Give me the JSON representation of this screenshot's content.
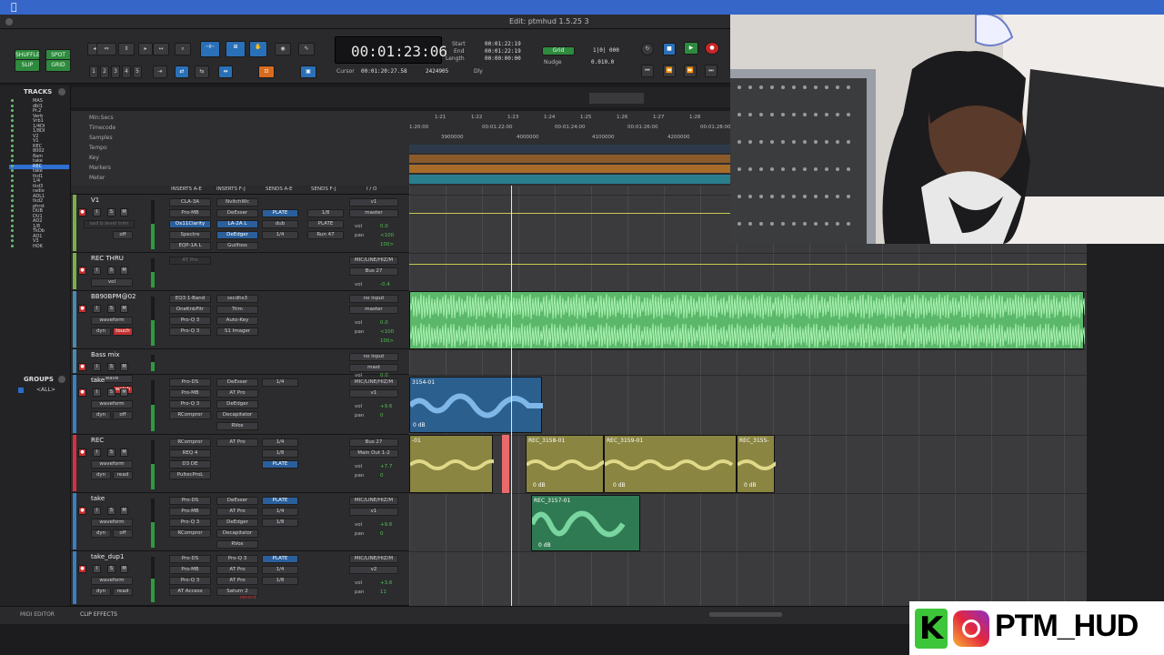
{
  "system": {
    "apple": ""
  },
  "window": {
    "title": "Edit: ptmhud 1.5.25 3"
  },
  "toolbar": {
    "modes": [
      "SHUFFLE",
      "SPOT",
      "SLIP",
      "GRID"
    ],
    "zoom_presets": [
      "1",
      "2",
      "3",
      "4",
      "5"
    ],
    "counter": "00:01:23:06",
    "start_label": "Start",
    "end_label": "End",
    "length_label": "Length",
    "start_val": "00:01:22:19",
    "end_val": "00:01:22:19",
    "length_val": "00:00:00:00",
    "cursor_label": "Cursor",
    "cursor_val": "00:01:20:27.58",
    "samples_val": "2424905",
    "dly_label": "Dly",
    "grid_label": "Grid",
    "grid_val": "1|0| 000",
    "nudge_label": "Nudge",
    "nudge_val": "0.010.0"
  },
  "tracks_panel": {
    "header": "TRACKS",
    "items": [
      "MAS",
      "dbl1",
      "Pr.2",
      "Verb",
      "Vrb1",
      "1/4DI",
      "1/8DI",
      "V2",
      "V1",
      "REC",
      "8002",
      "8am",
      "take",
      "REC",
      "take",
      "tkd1",
      "1/4",
      "tkd3",
      "radio",
      "ADL1",
      "tkd2",
      "phrst",
      "DUB",
      "DU1",
      "AD2",
      "1/8",
      "TkDb",
      "AD1",
      "V3",
      "HOK"
    ],
    "selected_index": 13
  },
  "groups_panel": {
    "header": "GROUPS",
    "items": [
      "<ALL>"
    ]
  },
  "rulers": {
    "labels": [
      "Min:Secs",
      "Timecode",
      "Samples",
      "Tempo",
      "Key",
      "Markers",
      "Meter"
    ],
    "min_secs": [
      "1:21",
      "1:22",
      "1:23",
      "1:24",
      "1:25",
      "1:26",
      "1:27",
      "1:28"
    ],
    "timecode": [
      "1:20:00",
      "00:01:22:00",
      "00:01:24:00",
      "00:01:26:00",
      "00:01:28:00"
    ],
    "samples": [
      "3900000",
      "4000000",
      "4100000",
      "4200000"
    ]
  },
  "mixer_headers": {
    "inserts_ae": "INSERTS A-E",
    "inserts_fj": "INSERTS F-J",
    "sends_ae": "SENDS A-E",
    "sends_fj": "SENDS F-J",
    "io": "I / O"
  },
  "tracks": [
    {
      "name": "V1",
      "inserts_ae": [
        "CLA-3A",
        "Pro-MB",
        "Ox11Clarity",
        "Spectre",
        "EQP-1A L"
      ],
      "inserts_fj": [
        "NvitchWc",
        "DeEsser",
        "LA-2A L",
        "DeEdger",
        "Guilfoss"
      ],
      "sends": [
        "PLATE",
        "dub",
        "1/4"
      ],
      "sends2": [
        "1/8",
        "PLATE",
        "Run 47"
      ],
      "io": [
        "v1",
        "master"
      ],
      "vol": "0.0",
      "pan": "<100",
      "pan2": "100>",
      "sub": "sad b level trim",
      "mode": "dyn",
      "auto": "off"
    },
    {
      "name": "REC THRU",
      "inserts_ae": [
        "AT Pro"
      ],
      "io": [
        "MIC/LINE/HIZ/M",
        "Bus 27"
      ],
      "vol": "-0.4",
      "mode": "vol"
    },
    {
      "name": "BB90BPM@02",
      "inserts_ae": [
        "EQ3 1-Band",
        "OneKnbFitr",
        "Pro-Q 3",
        "Pro-Q 3"
      ],
      "inserts_fj": [
        "sscdhs3",
        "Trim",
        "Auto-Key",
        "S1 Imager"
      ],
      "io": [
        "no input",
        "master"
      ],
      "vol": "0.0",
      "pan": "<100",
      "pan2": "100>",
      "mode": "waveform",
      "auto": "touch",
      "dyn": "dyn"
    },
    {
      "name": "Bass mix",
      "mode": "wave",
      "auto": "watch",
      "io": [
        "no input",
        "mast"
      ],
      "vol": "0.0"
    },
    {
      "name": "take",
      "inserts_ae": [
        "Pro-DS",
        "Pro-MB",
        "Pro-Q 3",
        "RCompror"
      ],
      "inserts_fj": [
        "DeEsser",
        "AT Pro",
        "DeEdger",
        "Decapitator",
        "RVox"
      ],
      "sends": [
        "1/4"
      ],
      "io": [
        "MIC/LINE/HIZ/M",
        "v1"
      ],
      "vol": "+9.6",
      "pan": "0",
      "mode": "waveform",
      "auto": "off",
      "dyn": "dyn"
    },
    {
      "name": "REC",
      "inserts_ae": [
        "RCompror",
        "REQ 4",
        "D3 DE",
        "PultecProL"
      ],
      "inserts_fj": [
        "AT Pro"
      ],
      "sends": [
        "1/4",
        "1/8",
        "PLATE"
      ],
      "io": [
        "Bus 27",
        "Main Out 1-2"
      ],
      "vol": "+7.7",
      "pan": "0",
      "mode": "waveform",
      "auto": "read",
      "dyn": "dyn"
    },
    {
      "name": "take",
      "inserts_ae": [
        "Pro-DS",
        "Pro-MB",
        "Pro-Q 3",
        "RCompror"
      ],
      "inserts_fj": [
        "DeEsser",
        "AT Pro",
        "DeEdger",
        "Decapitator",
        "RVox"
      ],
      "sends": [
        "PLATE",
        "1/4",
        "1/8"
      ],
      "io": [
        "MIC/LINE/HIZ/M",
        "v1"
      ],
      "vol": "+9.6",
      "pan": "0",
      "mode": "waveform",
      "auto": "off",
      "dyn": "dyn"
    },
    {
      "name": "take_dup1",
      "inserts_ae": [
        "Pro-DS",
        "Pro-MB",
        "Pro-Q 3",
        "AT Access"
      ],
      "inserts_fj": [
        "Pro-Q 3",
        "AT Pro",
        "AT Pro",
        "Saturn 2"
      ],
      "sends": [
        "PLATE",
        "1/4",
        "1/8"
      ],
      "io": [
        "MIC/LINE/HIZ/M",
        "v2"
      ],
      "vol": "+3.6",
      "pan": "11",
      "mode": "waveform",
      "auto": "read",
      "dyn": "dyn",
      "extra": "record"
    }
  ],
  "clips": [
    {
      "name": "3154-01",
      "track": 4
    },
    {
      "name": "-01",
      "track": 5
    },
    {
      "name": "REC_3158-01",
      "track": 5
    },
    {
      "name": "REC_3159-01",
      "track": 5
    },
    {
      "name": "REC_3155-",
      "track": 5
    },
    {
      "name": "REC_3157-01",
      "track": 6
    }
  ],
  "clip_gain": [
    "0 dB",
    "0 dB",
    "0 dB",
    "0 dB",
    "0 dB"
  ],
  "bottom": {
    "midi_editor": "MIDI EDITOR",
    "clip_effects": "CLIP EFFECTS"
  },
  "brand": {
    "handle": "PTM_HUD",
    "k_letter": "K"
  },
  "colors": {
    "accent_green": "#2e9a3e",
    "waveform_green": "#6fd47e",
    "clip_blue": "#3a7fc0",
    "clip_yellow": "#b8b055",
    "record_red": "#d63030",
    "playhead": "#e85050"
  }
}
